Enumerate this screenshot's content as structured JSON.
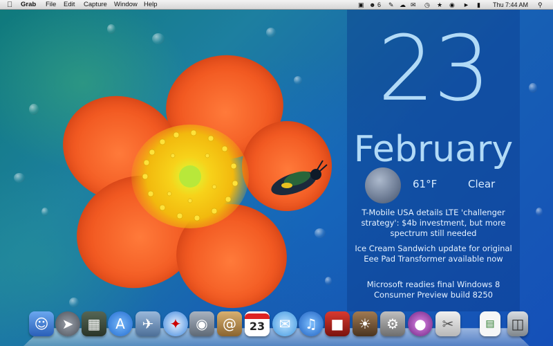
{
  "menubar": {
    "app_name": "Grab",
    "menus": [
      "File",
      "Edit",
      "Capture",
      "Window",
      "Help"
    ],
    "status": {
      "badge_count": "6",
      "clock": "Thu 7:44 AM"
    }
  },
  "widget": {
    "day": "23",
    "month": "February",
    "weather": {
      "temperature": "61°F",
      "condition": "Clear",
      "icon": "moon-icon"
    },
    "news": [
      "T-Mobile USA details LTE 'challenger strategy': $4b investment, but more spectrum still needed",
      "Ice Cream Sandwich update for original Eee Pad Transformer available now",
      "Microsoft readies final Windows 8 Consumer Preview build 8250"
    ]
  },
  "dock": {
    "items": [
      {
        "name": "finder",
        "icon": "finder-icon",
        "color": "#3a7bd5"
      },
      {
        "name": "launchpad",
        "icon": "rocket-icon",
        "color": "#6d6f78"
      },
      {
        "name": "mission-control",
        "icon": "mission-control-icon",
        "color": "#3c4a3a"
      },
      {
        "name": "app-store",
        "icon": "app-store-icon",
        "color": "#2f86e6"
      },
      {
        "name": "mail-stamp",
        "icon": "eagle-stamp-icon",
        "color": "#6b8fb8"
      },
      {
        "name": "safari",
        "icon": "compass-icon",
        "color": "#2d7fd6"
      },
      {
        "name": "facetime",
        "icon": "video-camera-icon",
        "color": "#7c8796"
      },
      {
        "name": "address-book",
        "icon": "address-book-icon",
        "color": "#b48a4e"
      },
      {
        "name": "ical",
        "icon": "calendar-icon",
        "color": "#ffffff",
        "label": "23"
      },
      {
        "name": "messages",
        "icon": "speech-bubbles-icon",
        "color": "#4aa6e8"
      },
      {
        "name": "itunes",
        "icon": "music-note-icon",
        "color": "#2e7ed8"
      },
      {
        "name": "photo-booth",
        "icon": "photo-booth-icon",
        "color": "#b5231e"
      },
      {
        "name": "iphoto",
        "icon": "iphoto-icon",
        "color": "#6a4d30"
      },
      {
        "name": "system-preferences",
        "icon": "gear-icon",
        "color": "#8d8d8d"
      },
      {
        "name": "itunes-purple",
        "icon": "orb-icon",
        "color": "#8b3c9c"
      },
      {
        "name": "grab",
        "icon": "scissors-icon",
        "color": "#d0d0d0"
      },
      {
        "name": "document",
        "icon": "document-icon",
        "color": "#f4f4f4"
      },
      {
        "name": "trash",
        "icon": "trash-icon",
        "color": "#9ea3a8"
      }
    ]
  }
}
